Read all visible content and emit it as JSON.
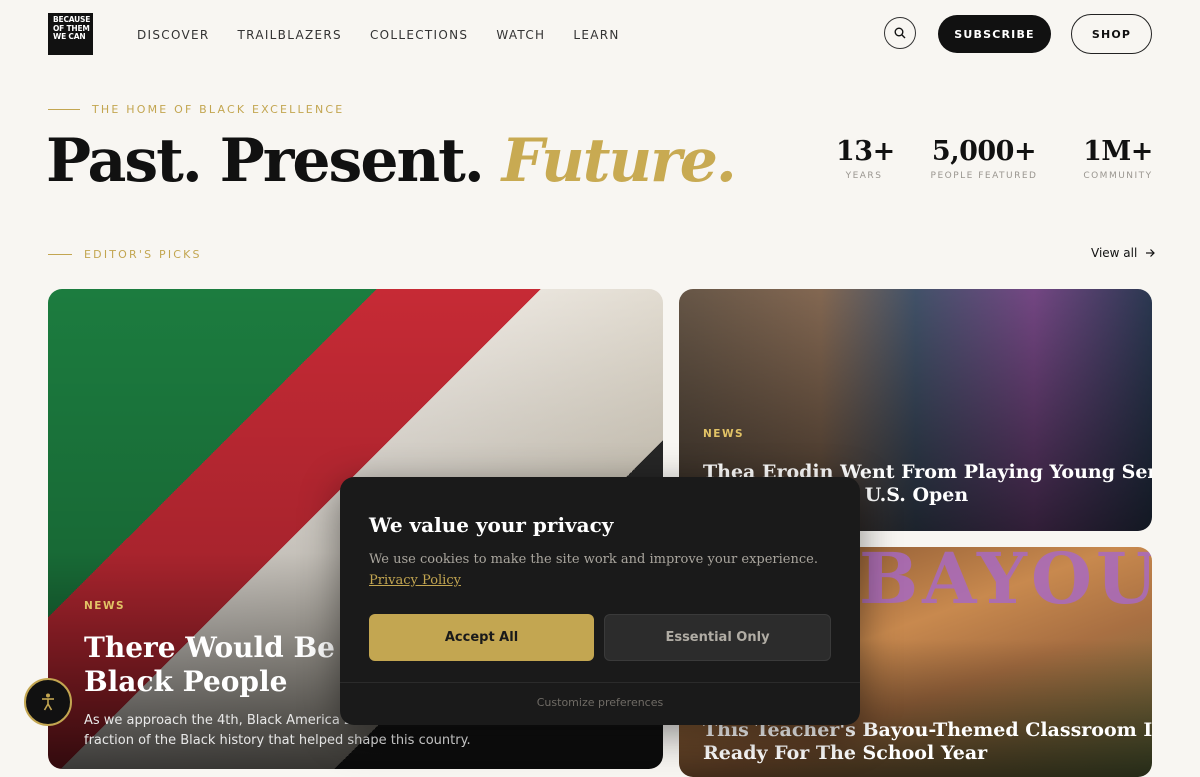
{
  "header": {
    "logo_lines": [
      "BECAUSE",
      "OF THEM",
      "WE CAN"
    ],
    "nav": [
      "DISCOVER",
      "TRAILBLAZERS",
      "COLLECTIONS",
      "WATCH",
      "LEARN"
    ],
    "subscribe_label": "SUBSCRIBE",
    "shop_label": "SHOP"
  },
  "hero": {
    "eyebrow": "THE HOME OF BLACK EXCELLENCE",
    "headline_part1": "Past. Present.",
    "headline_part2": "Future.",
    "stats": [
      {
        "value": "13+",
        "label": "YEARS"
      },
      {
        "value": "5,000+",
        "label": "PEOPLE FEATURED"
      },
      {
        "value": "1M+",
        "label": "COMMUNITY"
      }
    ]
  },
  "picks": {
    "label": "EDITOR'S PICKS",
    "view_all": "View all"
  },
  "cards": [
    {
      "tag": "NEWS",
      "title_line1": "There Would Be No A",
      "title_line2": "Black People",
      "excerpt_line1": "As we approach the 4th, Black America 250",
      "excerpt_line2": "fraction of the Black history that helped shape this country."
    },
    {
      "tag": "NEWS",
      "title_line1": "Thea Erodin Went From Playing Young Serena In",
      "title_line2": "Playing In The U.S. Open"
    },
    {
      "sign_text": "BAYOU",
      "title_line1": "This Teacher's Bayou-Themed Classroom Is",
      "title_line2": "Ready For The School Year"
    }
  ],
  "cookie": {
    "title": "We value your privacy",
    "text": "We use cookies to make the site work and improve your experience.",
    "link": "Privacy Policy",
    "accept": "Accept All",
    "essential": "Essential Only",
    "customize": "Customize preferences"
  },
  "colors": {
    "gold": "#c3a651",
    "dark": "#111111",
    "background": "#f8f6f2"
  }
}
